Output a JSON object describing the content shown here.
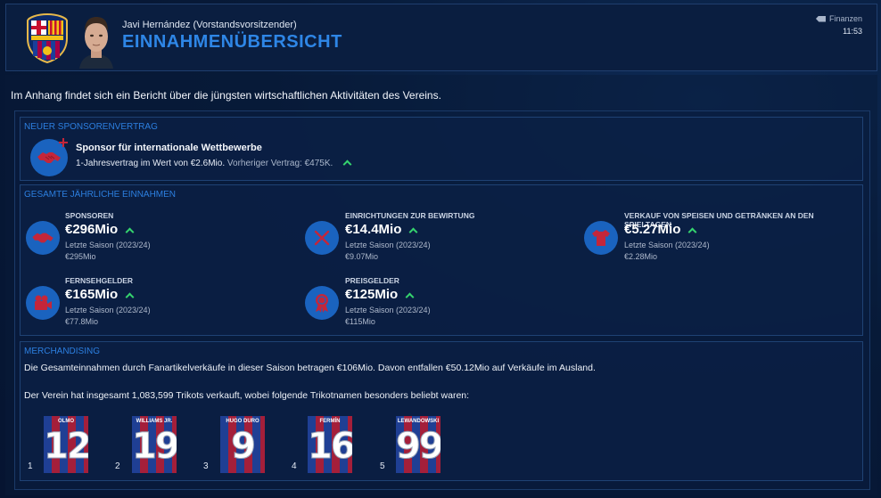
{
  "header": {
    "speaker": "Javi Hernández  (Vorstandsvorsitzender)",
    "title": "EINNAHMENÜBERSICHT",
    "section_tag": "Finanzen",
    "time": "11:53"
  },
  "intro": "Im Anhang findet sich ein Bericht über die jüngsten wirtschaftlichen Aktivitäten des Vereins.",
  "sponsorship": {
    "heading": "NEUER SPONSORENVERTRAG",
    "name": "Sponsor für internationale Wettbewerbe",
    "deal": "1-Jahresvertrag im Wert von €2.6Mio.",
    "previous": "Vorheriger Vertrag: €475K."
  },
  "income": {
    "heading": "GESAMTE JÄHRLICHE EINNAHMEN",
    "items": [
      {
        "label": "SPONSOREN",
        "value": "€296Mio",
        "season": "Letzte Saison (2023/24)",
        "prev": "€295Mio",
        "icon": "handshake-icon"
      },
      {
        "label": "EINRICHTUNGEN ZUR BEWIRTUNG",
        "value": "€14.4Mio",
        "season": "Letzte Saison (2023/24)",
        "prev": "€9.07Mio",
        "icon": "cutlery-icon"
      },
      {
        "label": "VERKAUF VON SPEISEN UND GETRÄNKEN AN DEN SPIELTAGEN",
        "value": "€5.27Mio",
        "season": "Letzte Saison (2023/24)",
        "prev": "€2.28Mio",
        "icon": "shirt-icon"
      },
      {
        "label": "FERNSEHGELDER",
        "value": "€165Mio",
        "season": "Letzte Saison (2023/24)",
        "prev": "€77.8Mio",
        "icon": "tv-camera-icon"
      },
      {
        "label": "PREISGELDER",
        "value": "€125Mio",
        "season": "Letzte Saison (2023/24)",
        "prev": "€115Mio",
        "icon": "rosette-icon"
      }
    ]
  },
  "merch": {
    "heading": "MERCHANDISING",
    "line1": "Die Gesamteinnahmen durch Fanartikelverkäufe in dieser Saison betragen €106Mio. Davon entfallen €50.12Mio auf Verkäufe im Ausland.",
    "line2": "Der Verein hat insgesamt 1,083,599 Trikots verkauft, wobei folgende Trikotnamen besonders beliebt waren:",
    "shirts": [
      {
        "rank": "1",
        "name": "OLMO",
        "number": "12"
      },
      {
        "rank": "2",
        "name": "WILLIAMS JR.",
        "number": "19"
      },
      {
        "rank": "3",
        "name": "HUGO DURO",
        "number": "9"
      },
      {
        "rank": "4",
        "name": "FERMÍN",
        "number": "16"
      },
      {
        "rank": "5",
        "name": "LEWANDOWSKI",
        "number": "99"
      }
    ]
  },
  "colors": {
    "accent": "#2e86e6",
    "up": "#35d46e",
    "icon_bg": "#1a63bf"
  }
}
